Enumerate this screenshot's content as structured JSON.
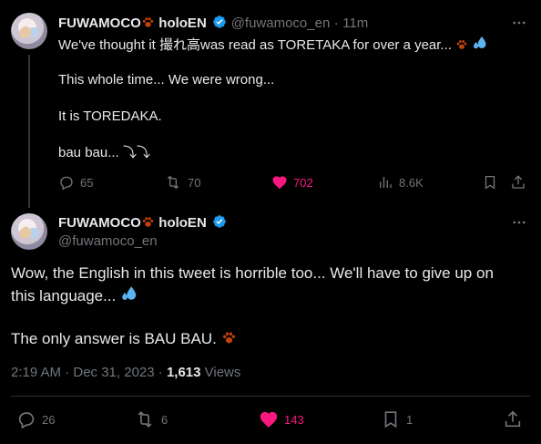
{
  "tweet1": {
    "author_name": "FUWAMOCO",
    "author_suffix": "holoEN",
    "handle": "@fuwamoco_en",
    "separator": "·",
    "time": "11m",
    "line1": "We've thought it 撮れ高was read as TORETAKA for over a year...",
    "line2": "This whole time... We were wrong...",
    "line3": "It is TOREDAKA.",
    "line4": "bau bau... ⤵⤵",
    "replies": "65",
    "reposts": "70",
    "likes": "702",
    "views": "8.6K"
  },
  "tweet2": {
    "author_name": "FUWAMOCO",
    "author_suffix": "holoEN",
    "handle": "@fuwamoco_en",
    "line1": "Wow, the English in this tweet is horrible too... We'll have to give up on",
    "line2": "this language...",
    "line3": "The only answer is BAU BAU.",
    "timestamp": "2:19 AM · Dec 31, 2023 · ",
    "views_count": "1,613",
    "views_label": " Views",
    "replies": "26",
    "reposts": "6",
    "likes": "143",
    "bookmarks": "1"
  },
  "colors": {
    "accent_verified": "#1d9bf0",
    "like": "#f91880",
    "muted": "#71767b",
    "paw": "#c2410c"
  },
  "icons": [
    "verified-badge-icon",
    "paw-icon",
    "sweat-drops-icon",
    "more-icon",
    "reply-icon",
    "repost-icon",
    "like-icon",
    "views-icon",
    "bookmark-icon",
    "share-icon"
  ]
}
